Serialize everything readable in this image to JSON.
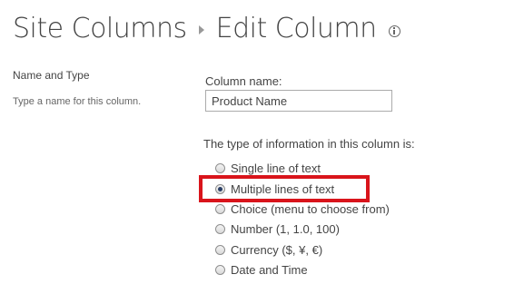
{
  "header": {
    "breadcrumb_parent": "Site Columns",
    "breadcrumb_current": "Edit Column",
    "info_icon": "info-circle-icon"
  },
  "section": {
    "title": "Name and Type",
    "description": "Type a name for this column."
  },
  "column_name": {
    "label": "Column name:",
    "value": "Product Name"
  },
  "type_section": {
    "label": "The type of information in this column is:",
    "options": [
      {
        "label": "Single line of text",
        "checked": false
      },
      {
        "label": "Multiple lines of text",
        "checked": true
      },
      {
        "label": "Choice (menu to choose from)",
        "checked": false
      },
      {
        "label": "Number (1, 1.0, 100)",
        "checked": false
      },
      {
        "label": "Currency ($, ¥, €)",
        "checked": false
      },
      {
        "label": "Date and Time",
        "checked": false
      }
    ]
  },
  "colors": {
    "highlight_border": "#d9141b",
    "text": "#444444"
  }
}
